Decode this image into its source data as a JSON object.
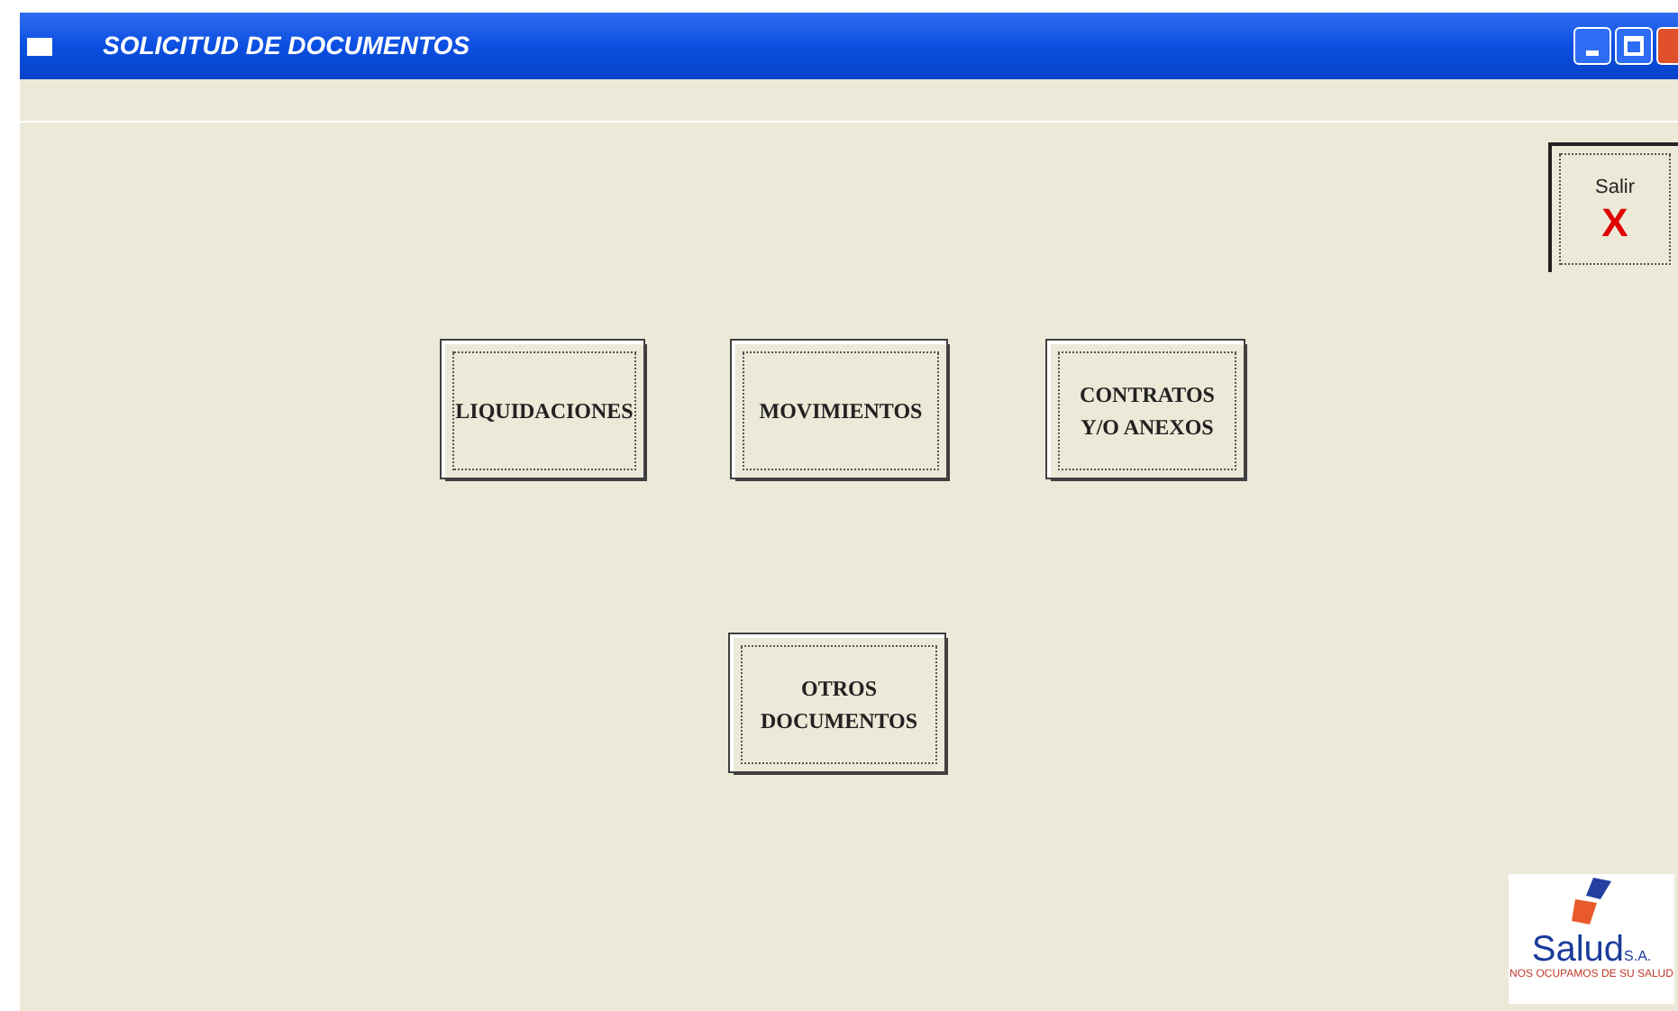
{
  "window": {
    "title": "SOLICITUD DE DOCUMENTOS"
  },
  "exit_button": {
    "label": "Salir",
    "icon": "X"
  },
  "buttons": [
    {
      "lines": [
        "LIQUIDACIONES"
      ]
    },
    {
      "lines": [
        "MOVIMIENTOS"
      ]
    },
    {
      "lines": [
        "CONTRATOS",
        "Y/O ANEXOS"
      ]
    },
    {
      "lines": [
        "OTROS",
        "DOCUMENTOS"
      ]
    }
  ],
  "logo": {
    "name": "Salud",
    "suffix": "S.A.",
    "tagline": "NOS OCUPAMOS DE SU SALUD"
  }
}
